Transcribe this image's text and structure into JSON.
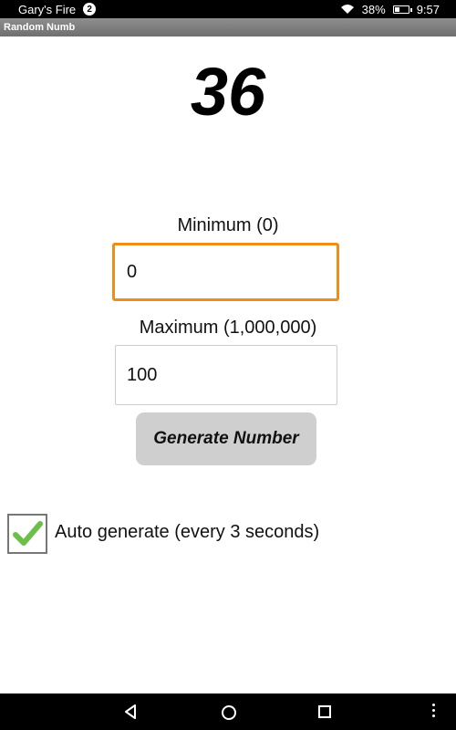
{
  "status_bar": {
    "carrier": "Gary's Fire",
    "notification_count": "2",
    "battery_percent": "38%",
    "battery_level": 0.38,
    "time": "9:57",
    "icons": [
      "wifi-icon",
      "battery-icon"
    ]
  },
  "app": {
    "title": "Random Numb"
  },
  "result": {
    "value": "36"
  },
  "minimum": {
    "label": "Minimum (0)",
    "value": "0"
  },
  "maximum": {
    "label": "Maximum (1,000,000)",
    "value": "100"
  },
  "generate_button": {
    "label": "Generate Number"
  },
  "auto_generate": {
    "label": "Auto generate (every 3 seconds)",
    "checked": true
  },
  "nav_bar": {
    "icons": [
      "back-icon",
      "home-icon",
      "recents-icon",
      "overflow-menu-icon"
    ]
  },
  "colors": {
    "focus_border": "#f08c1a",
    "check": "#6cc04a",
    "button_bg": "#cfcfcf"
  }
}
